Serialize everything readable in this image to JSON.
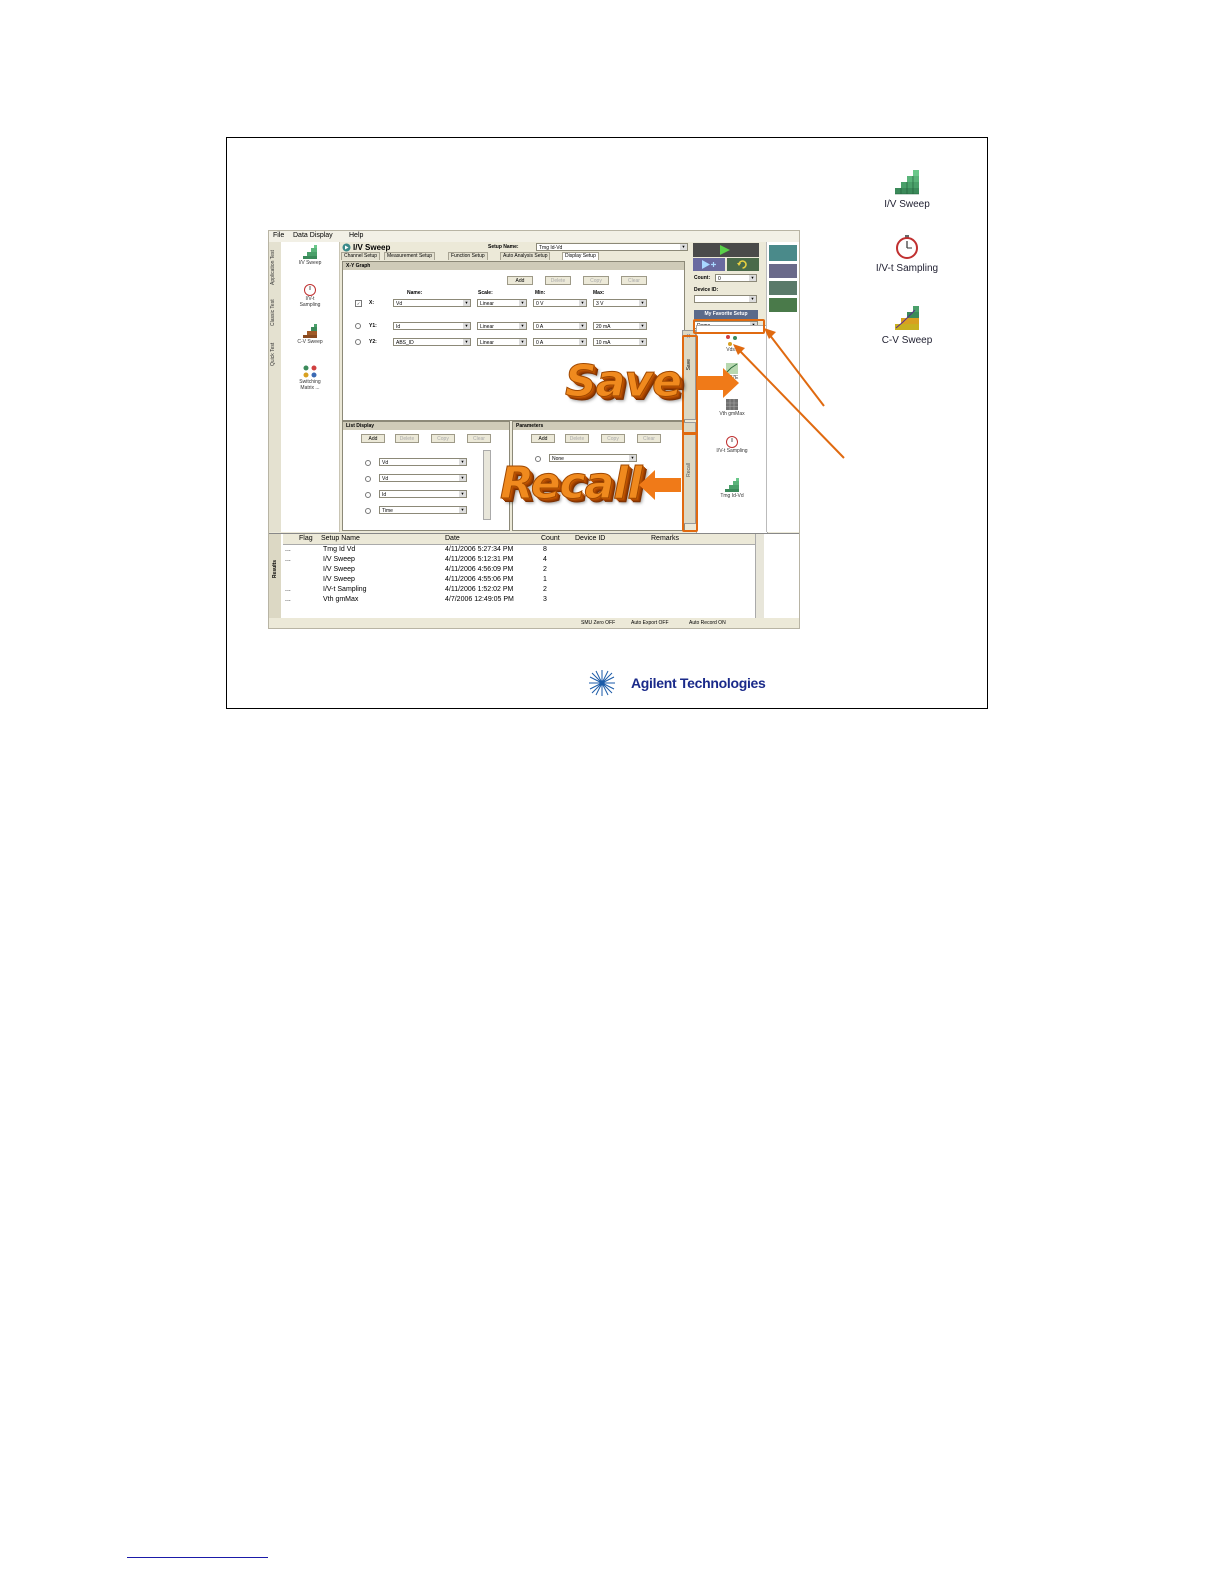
{
  "menu": {
    "file": "File",
    "data_display": "Data Display",
    "help": "Help"
  },
  "side_tabs": [
    "Application Test",
    "Classic Test",
    "Quick Test"
  ],
  "left_panel": {
    "items": [
      {
        "label": "I/V Sweep"
      },
      {
        "label": "I/V-t Sampling"
      },
      {
        "label": "C-V Sweep"
      },
      {
        "label": "Switching Matrix ..."
      }
    ]
  },
  "header": {
    "title": "I/V Sweep",
    "setup_name_label": "Setup Name:",
    "setup_name_value": "Tmg Id-Vd"
  },
  "tabs": [
    "Channel Setup",
    "Measurement Setup",
    "Function Setup",
    "Auto Analysis Setup",
    "Display Setup"
  ],
  "xy_graph": {
    "title": "X-Y Graph",
    "buttons": [
      "Add",
      "Delete",
      "Copy",
      "Clear"
    ],
    "col_name": "Name:",
    "col_scale": "Scale:",
    "col_min": "Min:",
    "col_max": "Max:",
    "rows": [
      {
        "axis": "X:",
        "name": "Vd",
        "scale": "Linear",
        "min": "0 V",
        "max": "3 V"
      },
      {
        "axis": "Y1:",
        "name": "Id",
        "scale": "Linear",
        "min": "0 A",
        "max": "20 mA"
      },
      {
        "axis": "Y2:",
        "name": "ABS_ID",
        "scale": "Linear",
        "min": "0 A",
        "max": "10 mA"
      }
    ]
  },
  "list_display": {
    "title": "List Display",
    "buttons": [
      "Add",
      "Delete",
      "Copy",
      "Clear"
    ],
    "items": [
      "Vd",
      "Vd",
      "Id",
      "Time"
    ]
  },
  "parameters": {
    "title": "Parameters",
    "buttons": [
      "Add",
      "Delete",
      "Copy",
      "Clear"
    ],
    "items": [
      "None"
    ]
  },
  "right_panel": {
    "count_label": "Count:",
    "count_value": "0",
    "device_id_label": "Device ID:",
    "fav_title": "My Favorite Setup",
    "fav_value": "Demo",
    "save_tab": "Save",
    "recall_tab": "Recall",
    "fav_items": [
      "Vds7",
      "BP7E",
      "Vth gmMax",
      "I/V-t Sampling",
      "Tmg Id-Vd"
    ]
  },
  "results": {
    "tab_label": "Results",
    "columns": [
      "Flag",
      "Setup Name",
      "Date",
      "Count",
      "Device ID",
      "Remarks"
    ],
    "rows": [
      {
        "flag": "...",
        "name": "Tmg Id Vd",
        "date": "4/11/2006 5:27:34 PM",
        "count": "8"
      },
      {
        "flag": "...",
        "name": "I/V Sweep",
        "date": "4/11/2006 5:12:31 PM",
        "count": "4"
      },
      {
        "flag": "",
        "name": "I/V Sweep",
        "date": "4/11/2006 4:56:09 PM",
        "count": "2"
      },
      {
        "flag": "",
        "name": "I/V Sweep",
        "date": "4/11/2006 4:55:06 PM",
        "count": "1"
      },
      {
        "flag": "...",
        "name": "I/V-t Sampling",
        "date": "4/11/2006 1:52:02 PM",
        "count": "2"
      },
      {
        "flag": "...",
        "name": "Vth gmMax",
        "date": "4/7/2006 12:49:05 PM",
        "count": "3"
      }
    ]
  },
  "status": [
    "SMU Zero OFF",
    "Auto Export OFF",
    "Auto Record ON"
  ],
  "callouts": {
    "save": "Save",
    "recall": "Recall"
  },
  "desktop_icons": [
    {
      "label": "I/V Sweep"
    },
    {
      "label": "I/V-t Sampling"
    },
    {
      "label": "C-V Sweep"
    }
  ],
  "brand": {
    "name": "Agilent Technologies"
  },
  "colors": {
    "accent": "#e06a10",
    "app_bg": "#ece9d8",
    "brand": "#1a2a8a"
  }
}
